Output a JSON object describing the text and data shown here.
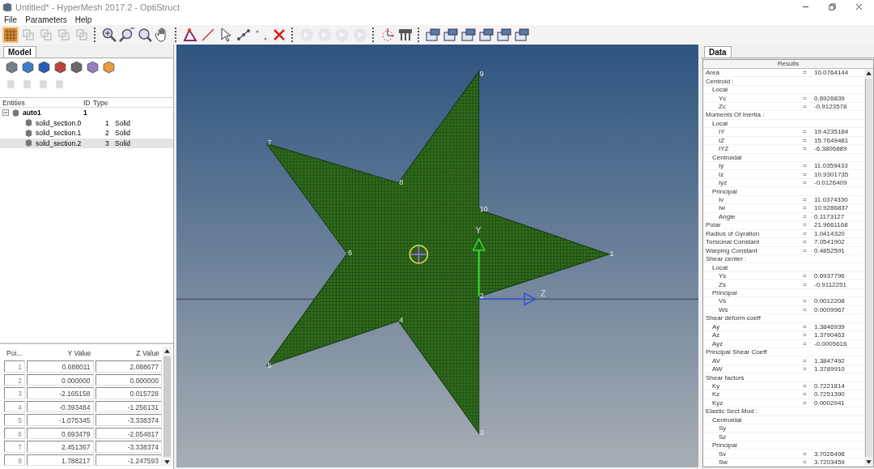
{
  "window": {
    "title": "Untitled* - HyperMesh 2017.2 - OptiStruct"
  },
  "menu": [
    "File",
    "Parameters",
    "Help"
  ],
  "left_panel": {
    "tab": {
      "label": "Model",
      "selected": true
    },
    "tree": {
      "columns": [
        "Entities",
        "ID",
        "Type"
      ],
      "items": [
        {
          "name": "auto1",
          "id": "1",
          "expanded": true,
          "children": [
            {
              "name": "solid_section.0",
              "id": "1",
              "type": "Solid",
              "selected": false
            },
            {
              "name": "solid_section.1",
              "id": "2",
              "type": "Solid",
              "selected": false
            },
            {
              "name": "solid_section.2",
              "id": "3",
              "type": "Solid",
              "selected": true
            }
          ]
        }
      ]
    },
    "points_table": {
      "columns": [
        "Poi...",
        "Y Value",
        "Z Value"
      ],
      "rows": [
        [
          "1",
          "0.688011",
          "2.088677"
        ],
        [
          "2",
          "0.000000",
          "0.000000"
        ],
        [
          "3",
          "-2.165158",
          "0.015728"
        ],
        [
          "4",
          "-0.393484",
          "-1.256131"
        ],
        [
          "5",
          "-1.075345",
          "-3.338374"
        ],
        [
          "6",
          "0.693479",
          "-2.054817"
        ],
        [
          "7",
          "2.451367",
          "-3.338374"
        ],
        [
          "8",
          "1.788217",
          "-1.247593"
        ]
      ]
    }
  },
  "canvas": {
    "node_labels": [
      "1",
      "2",
      "3",
      "4",
      "5",
      "6",
      "7",
      "8",
      "9",
      "10"
    ],
    "axis_labels": [
      "Y",
      "Z"
    ]
  },
  "right_panel": {
    "tab": {
      "label": "Data",
      "selected": true
    },
    "results": {
      "heading": "Results",
      "separator": "=",
      "rows": [
        {
          "label": "Area",
          "value": "10.0764144"
        },
        {
          "label": "Centroid :",
          "children": [
            {
              "label": "Local",
              "children": [
                {
                  "label": "Yc",
                  "value": "0.6926839"
                },
                {
                  "label": "Zc",
                  "value": "-0.9123578"
                }
              ]
            }
          ]
        },
        {
          "label": "Moments Of Inertia :",
          "children": [
            {
              "label": "Local",
              "children": [
                {
                  "label": "IY",
                  "value": "19.4235184"
                },
                {
                  "label": "IZ",
                  "value": "15.7649481"
                },
                {
                  "label": "IYZ",
                  "value": "-6.3806889"
                }
              ]
            },
            {
              "label": "Centroidal",
              "children": [
                {
                  "label": "Iy",
                  "value": "11.0359433"
                },
                {
                  "label": "Iz",
                  "value": "10.9301735"
                },
                {
                  "label": "Iyz",
                  "value": "-0.0126409"
                }
              ]
            },
            {
              "label": "Principal",
              "children": [
                {
                  "label": "Iv",
                  "value": "11.0374330"
                },
                {
                  "label": "Iw",
                  "value": "10.9286837"
                },
                {
                  "label": "Angle",
                  "value": "0.1173127"
                }
              ]
            }
          ]
        },
        {
          "label": "Polar",
          "value": "21.9661168"
        },
        {
          "label": "Radius of Gyration",
          "value": "1.0414320"
        },
        {
          "label": "Torsional Constant",
          "value": "7.0541902"
        },
        {
          "label": "Warping Constant",
          "value": "0.4852591"
        },
        {
          "label": "Shear center :",
          "children": [
            {
              "label": "Local",
              "children": [
                {
                  "label": "Ys",
                  "value": "0.6937796"
                },
                {
                  "label": "Zs",
                  "value": "-0.9112251"
                }
              ]
            },
            {
              "label": "Principal",
              "children": [
                {
                  "label": "Vs",
                  "value": "0.0012208"
                },
                {
                  "label": "Ws",
                  "value": "0.0009967"
                }
              ]
            }
          ]
        },
        {
          "label": "Shear deform coeff",
          "children": [
            {
              "label": "Ay",
              "value": "1.3846939"
            },
            {
              "label": "Az",
              "value": "1.3790463"
            },
            {
              "label": "Ayz",
              "value": "-0.0005616"
            }
          ]
        },
        {
          "label": "Principal Shear Coeff",
          "children": [
            {
              "label": "AV",
              "value": "1.3847492"
            },
            {
              "label": "AW",
              "value": "1.3789910"
            }
          ]
        },
        {
          "label": "Shear factors",
          "children": [
            {
              "label": "Ky",
              "value": "0.7221814"
            },
            {
              "label": "Kz",
              "value": "0.7251390"
            },
            {
              "label": "Kyz",
              "value": "0.0002941"
            }
          ]
        },
        {
          "label": "Elastic Sect Mod :",
          "children": [
            {
              "label": "Centroidal",
              "children": [
                {
                  "label": "Sy"
                },
                {
                  "label": "Sz"
                }
              ]
            },
            {
              "label": "Principal",
              "children": [
                {
                  "label": "Sv",
                  "value": "3.7026498"
                },
                {
                  "label": "Sw",
                  "value": "3.7203459"
                }
              ]
            }
          ]
        }
      ]
    }
  }
}
